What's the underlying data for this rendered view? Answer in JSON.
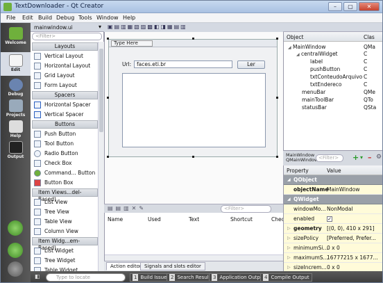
{
  "window": {
    "title": "TextDownloader - Qt Creator",
    "btn_min": "–",
    "btn_max": "▢",
    "btn_close": "✕"
  },
  "menu": [
    "File",
    "Edit",
    "Build",
    "Debug",
    "Tools",
    "Window",
    "Help"
  ],
  "modes": [
    {
      "label": "Welcome"
    },
    {
      "label": "Edit"
    },
    {
      "label": "Debug"
    },
    {
      "label": "Projects"
    },
    {
      "label": "Help"
    },
    {
      "label": "Output"
    }
  ],
  "filebar": {
    "filename": "mainwindow.ui"
  },
  "widgetbox": {
    "filter_placeholder": "<Filter>",
    "categories": {
      "layouts": "Layouts",
      "spacers": "Spacers",
      "buttons": "Buttons",
      "itemviews": "Item Views...del-Based)",
      "itemwidgets": "Item Widg...em-Based)"
    },
    "layouts": [
      "Vertical Layout",
      "Horizontal Layout",
      "Grid Layout",
      "Form Layout"
    ],
    "spacers": [
      "Horizontal Spacer",
      "Vertical Spacer"
    ],
    "buttons": [
      "Push Button",
      "Tool Button",
      "Radio Button",
      "Check Box",
      "Command... Button",
      "Button Box"
    ],
    "itemviews": [
      "List View",
      "Tree View",
      "Table View",
      "Column View"
    ],
    "itemwidgets": [
      "List Widget",
      "Tree Widget",
      "Table Widget"
    ]
  },
  "form": {
    "type_here": "Type Here",
    "url_label": "Url:",
    "url_value": "faces.eti.br",
    "ler_button": "Ler"
  },
  "action_editor": {
    "filter_placeholder": "<Filter>",
    "columns": [
      "Name",
      "Used",
      "Text",
      "Shortcut",
      "Chec"
    ],
    "tabs": [
      "Action editor",
      "Signals and slots editor"
    ]
  },
  "object_inspector": {
    "col_object": "Object",
    "col_class": "Clas",
    "rows": [
      {
        "name": "MainWindow",
        "cls": "QMa"
      },
      {
        "name": "centralWidget",
        "cls": "C"
      },
      {
        "name": "label",
        "cls": "C"
      },
      {
        "name": "pushButton",
        "cls": "C"
      },
      {
        "name": "txtConteudoArquivo",
        "cls": "C"
      },
      {
        "name": "txtEndereco",
        "cls": "C"
      },
      {
        "name": "menuBar",
        "cls": "QMe"
      },
      {
        "name": "mainToolBar",
        "cls": "QTo"
      },
      {
        "name": "statusBar",
        "cls": "QSta"
      }
    ]
  },
  "property_editor": {
    "title_line1": "MainWindow",
    "title_line2": "QMainWindow",
    "filter_placeholder": "<Filter>",
    "col_property": "Property",
    "col_value": "Value",
    "rows": [
      {
        "name": "QObject",
        "value": "",
        "group": true
      },
      {
        "name": "objectName",
        "value": "MainWindow"
      },
      {
        "name": "QWidget",
        "value": "",
        "group": true
      },
      {
        "name": "windowMo...",
        "value": "NonModal"
      },
      {
        "name": "enabled",
        "value": "✓"
      },
      {
        "name": "geometry",
        "value": "[(0, 0), 410 x 291]"
      },
      {
        "name": "sizePolicy",
        "value": "[Preferred, Prefer..."
      },
      {
        "name": "minimumSi...",
        "value": "0 x 0"
      },
      {
        "name": "maximumS...",
        "value": "16777215 x 1677..."
      },
      {
        "name": "sizeIncrem...",
        "value": "0 x 0"
      }
    ]
  },
  "statusbar": {
    "locate_placeholder": "Type to locate",
    "panes": [
      {
        "num": "1",
        "label": "Build Issues"
      },
      {
        "num": "2",
        "label": "Search Results"
      },
      {
        "num": "3",
        "label": "Application Output"
      },
      {
        "num": "4",
        "label": "Compile Output"
      }
    ]
  }
}
